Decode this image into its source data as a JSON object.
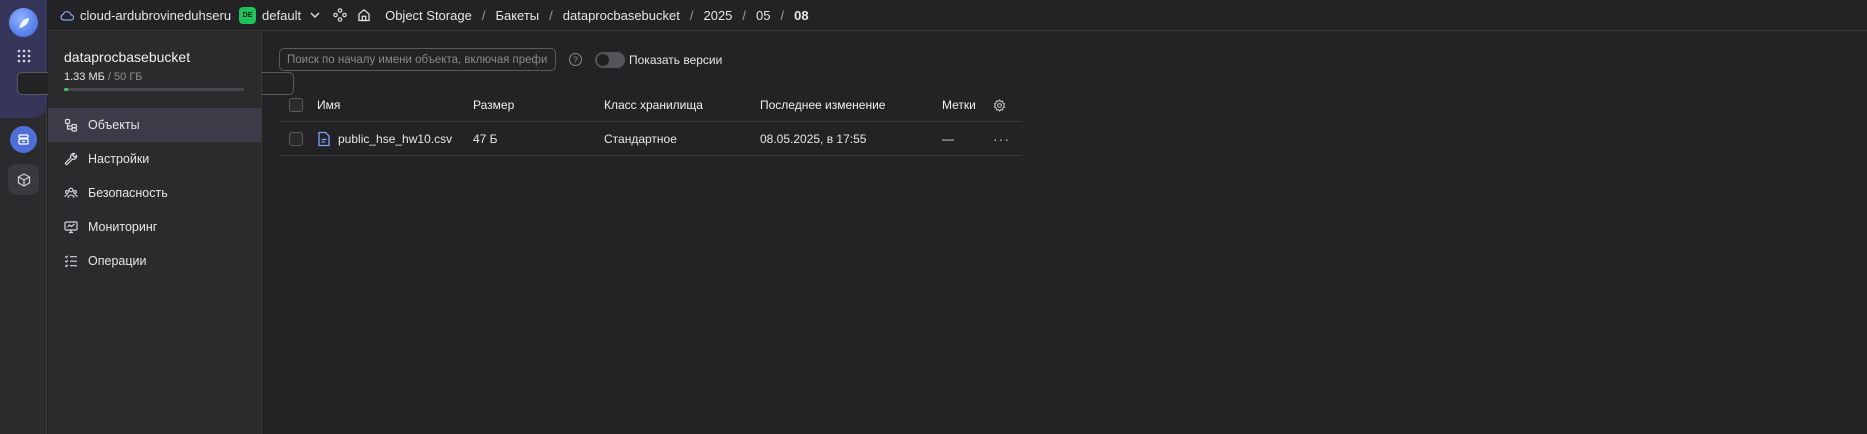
{
  "topbar": {
    "cloud_name": "cloud-ardubrovineduhseru",
    "folder_badge": "DE",
    "folder_name": "default",
    "breadcrumbs": [
      "Object Storage",
      "Бакеты",
      "dataprocbasebucket",
      "2025",
      "05",
      "08"
    ],
    "separator": "/"
  },
  "sidebar": {
    "bucket_name": "dataprocbasebucket",
    "usage_used": "1.33 МБ",
    "usage_total": "/ 50 ГБ",
    "usage_fraction": 3e-05,
    "nav": [
      {
        "label": "Объекты",
        "icon": "objects-icon",
        "active": true
      },
      {
        "label": "Настройки",
        "icon": "wrench-icon"
      },
      {
        "label": "Безопасность",
        "icon": "users-icon"
      },
      {
        "label": "Мониторинг",
        "icon": "monitor-icon"
      },
      {
        "label": "Операции",
        "icon": "list-icon"
      }
    ]
  },
  "main": {
    "search_placeholder": "Поиск по началу имени объекта, включая префикс",
    "show_versions_label": "Показать версии",
    "show_versions_on": false,
    "columns": {
      "name": "Имя",
      "size": "Размер",
      "storage_class": "Класс хранилища",
      "modified": "Последнее изменение",
      "tags": "Метки"
    },
    "rows": [
      {
        "name": "public_hse_hw10.csv",
        "size": "47 Б",
        "storage_class": "Стандартное",
        "modified": "08.05.2025, в 17:55",
        "tags": "—"
      }
    ]
  },
  "colors": {
    "background": "#232325",
    "panel": "#2b2b2d",
    "accent": "#4d6fd6",
    "badge_green": "#20c05a"
  }
}
